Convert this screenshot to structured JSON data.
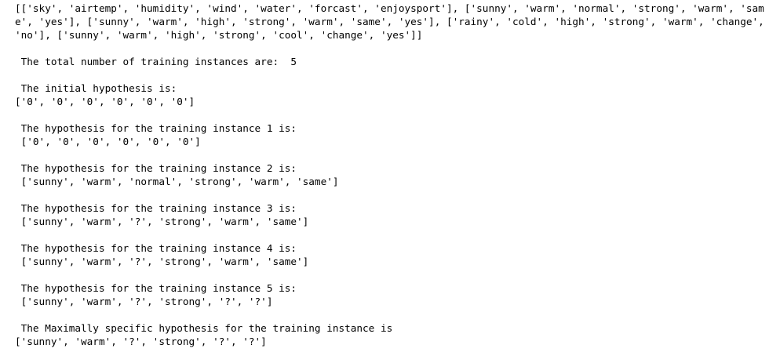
{
  "output": {
    "dataset_lines": [
      "[['sky', 'airtemp', 'humidity', 'wind', 'water', 'forcast', 'enjoysport'], ['sunny', 'warm', 'normal', 'strong', 'warm', 'sam",
      "e', 'yes'], ['sunny', 'warm', 'high', 'strong', 'warm', 'same', 'yes'], ['rainy', 'cold', 'high', 'strong', 'warm', 'change',",
      "'no'], ['sunny', 'warm', 'high', 'strong', 'cool', 'change', 'yes']]"
    ],
    "total_line": " The total number of training instances are:  5",
    "initial_label": " The initial hypothesis is:",
    "initial_value": "['0', '0', '0', '0', '0', '0']",
    "instances": [
      {
        "label": " The hypothesis for the training instance 1 is:",
        "value": " ['0', '0', '0', '0', '0', '0']"
      },
      {
        "label": " The hypothesis for the training instance 2 is:",
        "value": " ['sunny', 'warm', 'normal', 'strong', 'warm', 'same']"
      },
      {
        "label": " The hypothesis for the training instance 3 is:",
        "value": " ['sunny', 'warm', '?', 'strong', 'warm', 'same']"
      },
      {
        "label": " The hypothesis for the training instance 4 is:",
        "value": " ['sunny', 'warm', '?', 'strong', 'warm', 'same']"
      },
      {
        "label": " The hypothesis for the training instance 5 is:",
        "value": " ['sunny', 'warm', '?', 'strong', '?', '?']"
      }
    ],
    "final_label": " The Maximally specific hypothesis for the training instance is",
    "final_value": "['sunny', 'warm', '?', 'strong', '?', '?']"
  }
}
